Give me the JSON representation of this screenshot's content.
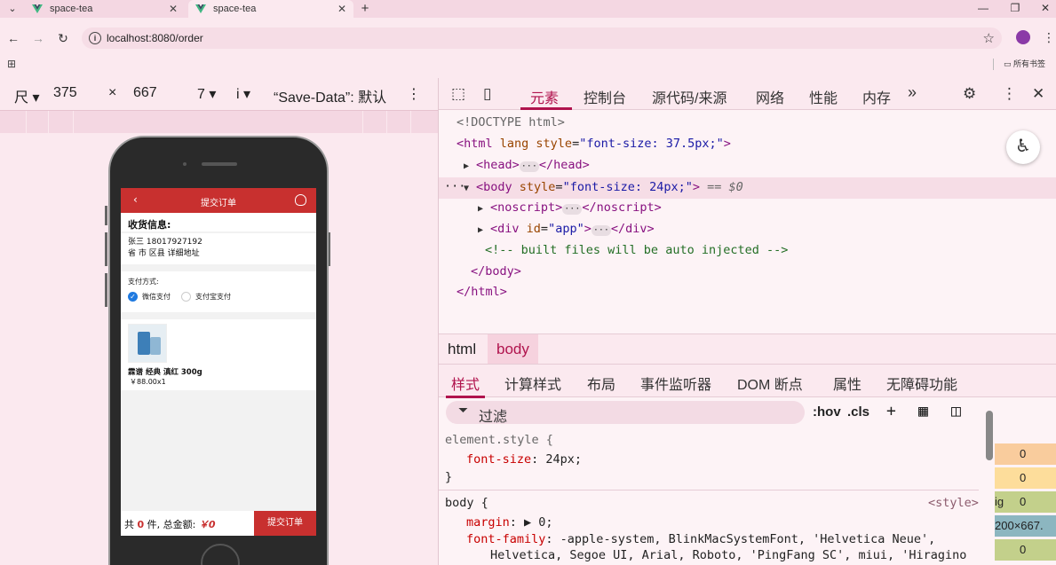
{
  "browser": {
    "tabs": [
      {
        "title": "space-tea",
        "active": false
      },
      {
        "title": "space-tea",
        "active": true
      }
    ],
    "new_tab_icon": "+",
    "url": "localhost:8080/order",
    "bookmarks_folder": "所有书签"
  },
  "device_toolbar": {
    "dimensions_label": "尺",
    "width": "375",
    "x": "×",
    "height": "667",
    "zoom": "7",
    "throttle": "i",
    "save_data": "“Save-Data”: 默认"
  },
  "app": {
    "header_title": "提交订单",
    "back_icon": "‹",
    "address_title": "收货信息:",
    "address_name_phone": "张三 18017927192",
    "address_detail": "省 市 区县 详细地址",
    "payment_label": "支付方式:",
    "payment_options": [
      "微信支付",
      "支付宝支付"
    ],
    "product_name": "霖谱 经典 滇红 300g",
    "product_price": "￥88.00x1",
    "summary_prefix": "共",
    "summary_count": "0",
    "summary_mid": "件, 总金额:",
    "summary_total": "￥0",
    "submit_label": "提交订单"
  },
  "devtools": {
    "tabs": [
      "元素",
      "控制台",
      "源代码/来源",
      "网络",
      "性能",
      "内存"
    ],
    "more": "»",
    "dom": {
      "doctype": "<!DOCTYPE html>",
      "html_open_tag": "<html",
      "html_attr_name": "lang style",
      "html_attr_value": "\"font-size: 37.5px;\"",
      "html_close_bracket": ">",
      "head_open": "<head>",
      "head_close": "</head>",
      "body_open_tag": "<body",
      "body_attr_name": "style",
      "body_attr_value": "\"font-size: 24px;\"",
      "body_close_bracket": ">",
      "body_marker": "== $0",
      "noscript_open": "<noscript>",
      "noscript_close": "</noscript>",
      "div_open_tag": "<div",
      "div_attr_name": "id",
      "div_attr_value": "\"app\"",
      "div_open_close": ">",
      "div_close": "</div>",
      "comment": "<!-- built files will be auto injected -->",
      "body_close": "</body>",
      "html_close": "</html>",
      "ellipsis": "···"
    },
    "breadcrumbs": [
      "html",
      "body"
    ],
    "sub_tabs": [
      "样式",
      "计算样式",
      "布局",
      "事件监听器",
      "DOM 断点",
      "属性",
      "无障碍功能"
    ],
    "filter_placeholder": "过滤",
    "hov": ":hov",
    "cls": ".cls",
    "rules": {
      "element_selector": "element.style {",
      "element_prop": "font-size",
      "element_val": "24px;",
      "close": "}",
      "body_selector": "body {",
      "body_source": "<style>",
      "margin_prop": "margin",
      "margin_val": "▶ 0;",
      "ff_prop": "font-family",
      "ff_val": "-apple-system, BlinkMacSystemFont, 'Helvetica Neue',",
      "ff_val2": "Helvetica, Segoe UI, Arial, Roboto, 'PingFang SC', miui, 'Hiragino"
    },
    "box_model": [
      "0",
      "0",
      "0",
      "200×667.",
      "0"
    ],
    "box_model_labels": [
      "",
      "",
      "ig",
      "",
      ""
    ]
  },
  "colors": {
    "accent": "#c8302f",
    "devtools_accent": "#b0134d",
    "chrome_bg": "#fbe9ef"
  }
}
